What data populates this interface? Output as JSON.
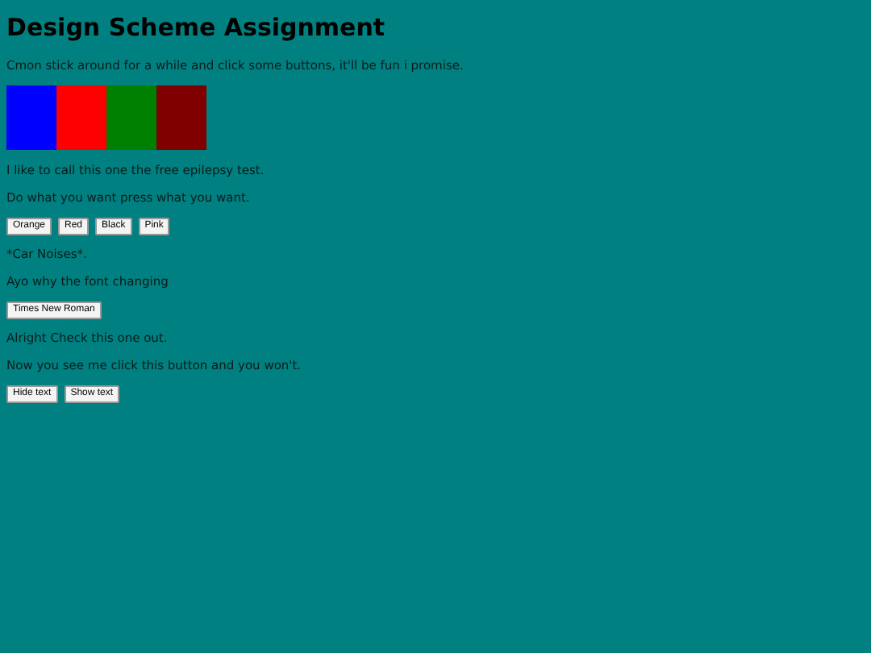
{
  "title": "Design Scheme Assignment",
  "content": [
    {
      "kind": "text",
      "text": "Cmon stick around for a while and click some buttons, it'll be fun i promise."
    },
    {
      "kind": "swatches",
      "items": [
        {
          "color": "#0000ff"
        },
        {
          "color": "#ff0000"
        },
        {
          "color": "#008000"
        },
        {
          "color": "#800000"
        }
      ]
    },
    {
      "kind": "text",
      "text": "I like to call this one the free epilepsy test."
    },
    {
      "kind": "text",
      "text": "Do what you want press what you want."
    },
    {
      "kind": "buttons",
      "items": [
        "Orange",
        "Red",
        "Black",
        "Pink"
      ]
    },
    {
      "kind": "text",
      "text": "*Car Noises*."
    },
    {
      "kind": "text",
      "text": "Ayo why the font changing"
    },
    {
      "kind": "buttons",
      "items": [
        "Times New Roman"
      ]
    },
    {
      "kind": "text",
      "text": "Alright Check this one out."
    },
    {
      "kind": "text",
      "text": "Now you see me click this button and you won't."
    },
    {
      "kind": "buttons",
      "items": [
        "Hide text",
        "Show text"
      ]
    }
  ]
}
